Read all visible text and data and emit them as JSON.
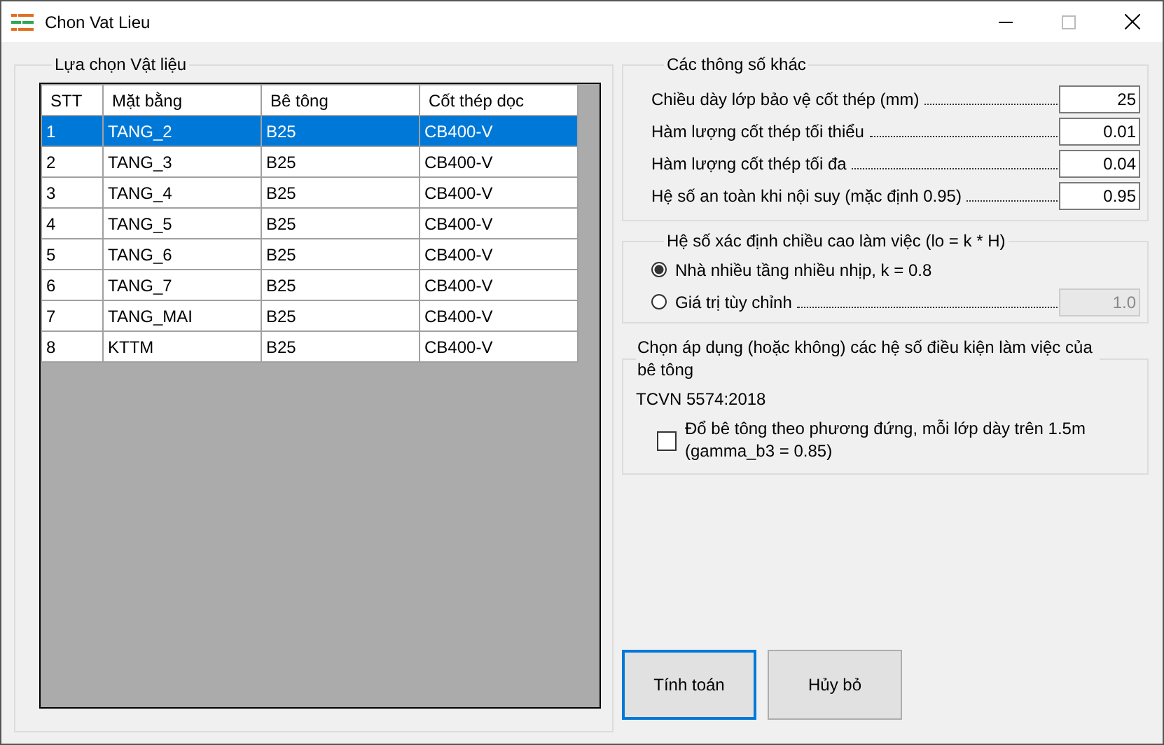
{
  "window": {
    "title": "Chon Vat Lieu"
  },
  "materials": {
    "title": "Lựa chọn Vật liệu",
    "columns": [
      "STT",
      "Mặt bằng",
      "Bê tông",
      "Cốt thép dọc"
    ],
    "rows": [
      {
        "cells": [
          "1",
          "TANG_2",
          "B25",
          "CB400-V"
        ],
        "selected": true
      },
      {
        "cells": [
          "2",
          "TANG_3",
          "B25",
          "CB400-V"
        ],
        "selected": false
      },
      {
        "cells": [
          "3",
          "TANG_4",
          "B25",
          "CB400-V"
        ],
        "selected": false
      },
      {
        "cells": [
          "4",
          "TANG_5",
          "B25",
          "CB400-V"
        ],
        "selected": false
      },
      {
        "cells": [
          "5",
          "TANG_6",
          "B25",
          "CB400-V"
        ],
        "selected": false
      },
      {
        "cells": [
          "6",
          "TANG_7",
          "B25",
          "CB400-V"
        ],
        "selected": false
      },
      {
        "cells": [
          "7",
          "TANG_MAI",
          "B25",
          "CB400-V"
        ],
        "selected": false
      },
      {
        "cells": [
          "8",
          "KTTM",
          "B25",
          "CB400-V"
        ],
        "selected": false
      }
    ]
  },
  "other_params": {
    "title": "Các thông số khác",
    "fields": [
      {
        "label": "Chiều dày lớp bảo vệ cốt thép (mm)",
        "value": "25"
      },
      {
        "label": "Hàm lượng cốt thép tối thiểu",
        "value": "0.01"
      },
      {
        "label": "Hàm lượng cốt thép tối đa",
        "value": "0.04"
      },
      {
        "label": "Hệ số an toàn khi nội suy (mặc định 0.95)",
        "value": "0.95"
      }
    ]
  },
  "height_factor": {
    "title": "Hệ số xác định chiều cao làm việc (lo = k * H)",
    "options": [
      {
        "label": "Nhà nhiều tầng nhiều nhịp, k = 0.8",
        "selected": true
      },
      {
        "label": "Giá trị tùy chỉnh",
        "selected": false,
        "value": "1.0",
        "disabled": true
      }
    ]
  },
  "conditions": {
    "title": "Chọn áp dụng (hoặc không) các hệ số điều kiện làm việc của bê tông",
    "standard": "TCVN 5574:2018",
    "options": [
      {
        "label": "Đổ bê tông theo phương đứng, mỗi lớp dày trên 1.5m (gamma_b3 = 0.85)",
        "checked": false
      }
    ]
  },
  "buttons": [
    {
      "label": "Tính toán",
      "focused": true
    },
    {
      "label": "Hủy bỏ",
      "focused": false
    }
  ]
}
